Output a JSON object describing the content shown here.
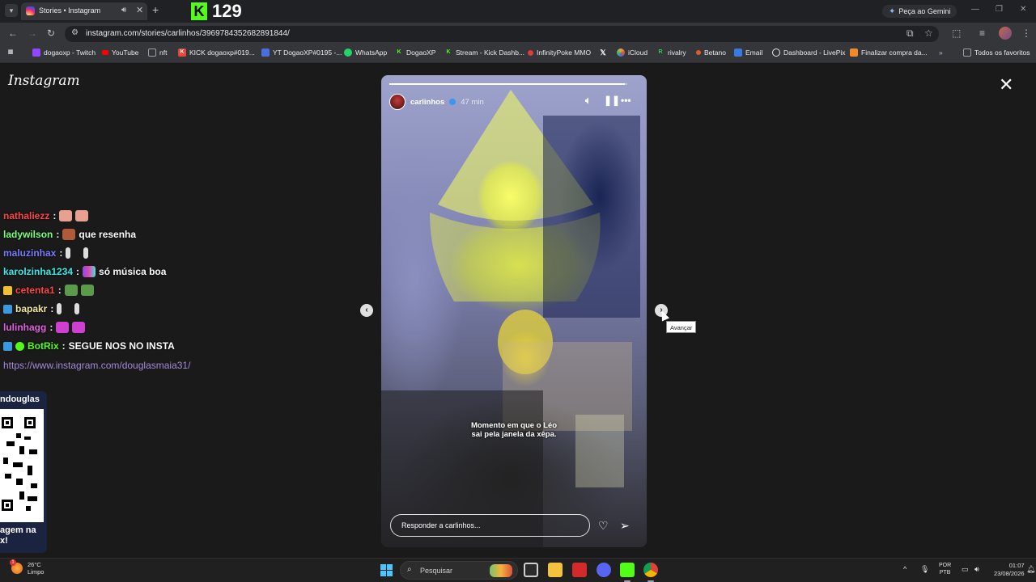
{
  "browser": {
    "tab_title": "Stories • Instagram",
    "kick_count": "129",
    "gemini_label": "Peça ao Gemini",
    "url": "instagram.com/stories/carlinhos/3969784352682891844/",
    "bookmarks": [
      {
        "label": "dogaoxp - Twitch",
        "icon": "twitch-icon",
        "color": "#9146ff"
      },
      {
        "label": "YouTube",
        "icon": "youtube-icon",
        "color": "#ff0000"
      },
      {
        "label": "nft",
        "icon": "folder-icon",
        "color": "#9aa0a6"
      },
      {
        "label": "KICK dogaoxp#019...",
        "icon": "kick-icon",
        "color": "#e8453c"
      },
      {
        "label": "YT DogaoXP#0195 -...",
        "icon": "doc-icon",
        "color": "#4a6ee0"
      },
      {
        "label": "WhatsApp",
        "icon": "whatsapp-icon",
        "color": "#25d366"
      },
      {
        "label": "DogaoXP",
        "icon": "kick-icon",
        "color": "#53fc18"
      },
      {
        "label": "Stream - Kick Dashb...",
        "icon": "kick-icon",
        "color": "#53fc18"
      },
      {
        "label": "InfinityPoke MMO",
        "icon": "pokeball-icon",
        "color": "#e03a3a"
      },
      {
        "label": "",
        "icon": "x-icon",
        "color": "#ffffff"
      },
      {
        "label": "iCloud",
        "icon": "icloud-icon",
        "color": "#f0a53a"
      },
      {
        "label": "rivalry",
        "icon": "rivalry-icon",
        "color": "#3ac35a"
      },
      {
        "label": "Betano",
        "icon": "betano-icon",
        "color": "#e05a2a"
      },
      {
        "label": "Email",
        "icon": "email-icon",
        "color": "#3a7ae0"
      },
      {
        "label": "Dashboard - LivePix",
        "icon": "livepix-icon",
        "color": "#e8eaed"
      },
      {
        "label": "Finalizar compra da...",
        "icon": "cart-icon",
        "color": "#f08a2a"
      }
    ],
    "all_bookmarks_label": "Todos os favoritos"
  },
  "instagram": {
    "logo": "Instagram",
    "story": {
      "username": "carlinhos",
      "time": "47 min",
      "caption_line1": "Momento em que o Léo",
      "caption_line2": "sai pela janela da xêpa.",
      "reply_placeholder": "Responder a carlinhos...",
      "progress": 0.99
    },
    "next_tooltip": "Avançar"
  },
  "chat": {
    "messages": [
      {
        "user": "nathaliezz",
        "color": "#ff4545",
        "text": "",
        "emote_color": "#e8a090",
        "emote_count": 2,
        "badge": ""
      },
      {
        "user": "ladywilson",
        "color": "#7dff7d",
        "text": "que resenha",
        "emote_color": "#b05a3a",
        "emote_count": 1,
        "badge": ""
      },
      {
        "user": "maluzinhax",
        "color": "#7a7aff",
        "text": "",
        "emote_color": "#dddddd",
        "emote_count": 2,
        "badge": ""
      },
      {
        "user": "karolzinha1234",
        "color": "#3ae8e8",
        "text": "só música boa",
        "emote_color": "#8a4ae0",
        "emote_count": 1,
        "badge": ""
      },
      {
        "user": "cetenta1",
        "color": "#ff4545",
        "text": "",
        "emote_color": "#5a9a4a",
        "emote_count": 2,
        "badge": "#f0c030"
      },
      {
        "user": "bapakr",
        "color": "#f0e6a0",
        "text": "",
        "emote_color": "#dddddd",
        "emote_count": 2,
        "badge": "#3a9ae0"
      },
      {
        "user": "lulinhagg",
        "color": "#e060e0",
        "text": "",
        "emote_color": "#d040d0",
        "emote_count": 2,
        "badge": ""
      },
      {
        "user": "BotRix",
        "color": "#53fc18",
        "text": "SEGUE NOS NO INSTA",
        "emote_color": "",
        "emote_count": 0,
        "badge": "#3a9ae0"
      }
    ],
    "link": "https://www.instagram.com/douglasmaia31/"
  },
  "qr_panel": {
    "title": "ndouglas",
    "footer_line1": "agem na",
    "footer_line2": "x!"
  },
  "taskbar": {
    "temperature": "26°C",
    "weather": "Limpo",
    "search_placeholder": "Pesquisar",
    "lang_line1": "POR",
    "lang_line2": "PTB",
    "time": "01:07",
    "date": "23/08/2026"
  }
}
